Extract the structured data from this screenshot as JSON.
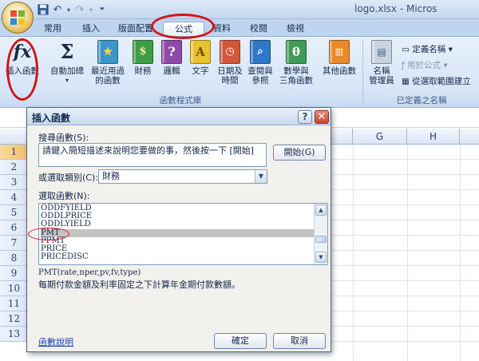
{
  "app": {
    "window_title": "logo.xlsx - Micros"
  },
  "quick_access": {
    "icons": [
      "save-icon",
      "undo-icon",
      "redo-icon",
      "customize-qat-icon"
    ]
  },
  "tabs": [
    {
      "label": "常用",
      "active": false
    },
    {
      "label": "插入",
      "active": false
    },
    {
      "label": "版面配置",
      "active": false
    },
    {
      "label": "公式",
      "active": true
    },
    {
      "label": "資料",
      "active": false
    },
    {
      "label": "校閱",
      "active": false
    },
    {
      "label": "檢視",
      "active": false
    }
  ],
  "ribbon": {
    "function_library": {
      "group_label": "函數程式庫",
      "insert_function": {
        "line1": "插入函數",
        "glyph": "fx"
      },
      "autosum": {
        "line1": "自動加總",
        "glyph": "Σ"
      },
      "recent": {
        "line1": "最近用過",
        "line2": "的函數"
      },
      "financial": {
        "line1": "財務"
      },
      "logical": {
        "line1": "邏輯",
        "glyph": "?"
      },
      "text": {
        "line1": "文字",
        "glyph": "A"
      },
      "datetime": {
        "line1": "日期及",
        "line2": "時間"
      },
      "lookup": {
        "line1": "查閱與",
        "line2": "參照"
      },
      "math": {
        "line1": "數學與",
        "line2": "三角函數",
        "glyph": "θ"
      },
      "more": {
        "line1": "其他函數"
      }
    },
    "defined_names": {
      "group_label": "已定義之名稱",
      "name_manager": {
        "line1": "名稱",
        "line2": "管理員"
      },
      "define_name": "定義名稱",
      "use_in_formula": "用於公式",
      "create_from_selection": "從選取範圍建立"
    },
    "colors": {
      "book_financial": "#3d9c46",
      "book_logical": "#8e4aa8",
      "book_text": "#e7c22e",
      "book_datetime": "#d5573b",
      "book_lookup": "#2f77c9",
      "book_math": "#3f9a55",
      "book_more": "#e88a2a",
      "book_recent": "#3a95c8"
    }
  },
  "grid": {
    "col_headers": [
      "G",
      "H"
    ],
    "row_headers": [
      "1",
      "2",
      "3",
      "4",
      "5",
      "6",
      "7",
      "8",
      "9",
      "10",
      "11",
      "12",
      "13"
    ]
  },
  "dialog": {
    "title": "插入函數",
    "help_glyph": "?",
    "close_glyph": "✕",
    "search_label": "搜尋函數(S):",
    "search_value": "請鍵入簡短描述來說明您要做的事，然後按一下 [開始]",
    "go_button": "開始(G)",
    "category_label": "或選取類別(C):",
    "category_value": "財務",
    "function_label": "選取函數(N):",
    "functions": [
      "ODDFYIELD",
      "ODDLPRICE",
      "ODDLYIELD",
      "PMT",
      "PPMT",
      "PRICE",
      "PRICEDISC"
    ],
    "selected_function": "PMT",
    "syntax": "PMT(rate,nper,pv,fv,type)",
    "description": "每期付款金額及利率固定之下計算年金期付款數額。",
    "help_link": "函數說明",
    "ok_button": "確定",
    "cancel_button": "取消"
  }
}
